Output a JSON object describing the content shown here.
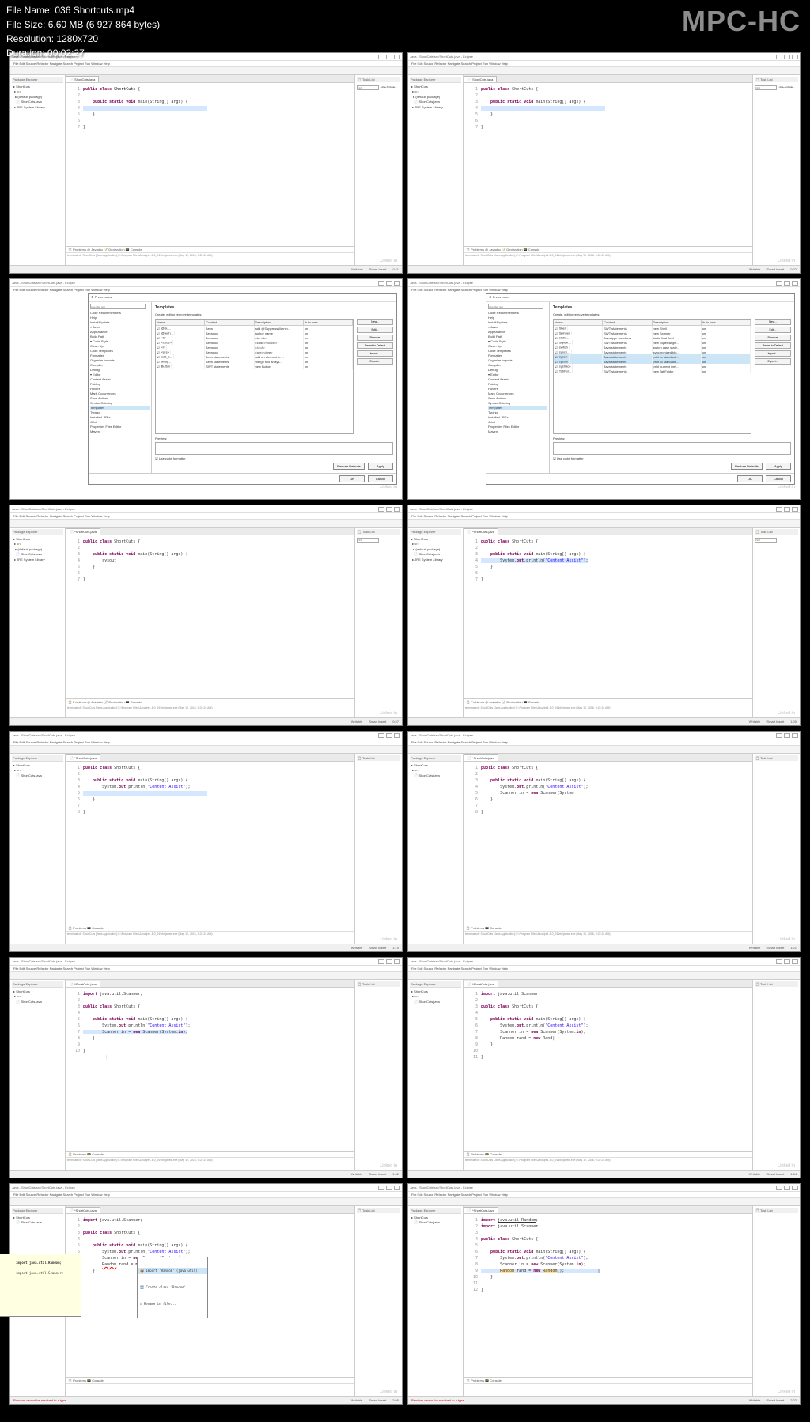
{
  "file_info": {
    "name_lbl": "File Name:",
    "name": "036 Shortcuts.mp4",
    "size_lbl": "File Size:",
    "size": "6.60 MB (6 927 864 bytes)",
    "res_lbl": "Resolution:",
    "res": "1280x720",
    "dur_lbl": "Duration:",
    "dur": "00:02:27"
  },
  "watermark": "MPC-HC",
  "eclipse": {
    "title": "Java - ShortCuts/src/ShortCuts.java - Eclipse",
    "menu": "File  Edit  Source  Refactor  Navigate  Search  Project  Run  Window  Help",
    "pkg_explorer": "Package Explorer",
    "project": "ShortCuts",
    "src": "src",
    "defpkg": "(default package)",
    "javafile": "ShortCuts.java",
    "jre": "JRE System Library",
    "tab": "ShortCuts.java",
    "tasklist": "Task List",
    "find": "Find",
    "all": "All",
    "activate": "Activate...",
    "problems": "Problems",
    "javadoc": "Javadoc",
    "declaration": "Declaration",
    "console": "Console",
    "terminated": "terminated> ShortCuts [Java Application] C:\\Program Files\\Java\\jre1.8.0_91\\bin\\javaw.exe (May 12, 2016, 9:22:24 AM)",
    "status_writable": "Writable",
    "status_insert": "Smart Insert",
    "linkedin": "Linked in"
  },
  "code": {
    "f1_l1": "public class ShortCuts {",
    "f1_l2": "    public static void main(String[] args) {",
    "f1_l3": "    }",
    "f1_l4": "}",
    "f5_l3": "        sysout",
    "f6_l3": "        System.out.println(\"Content Assist\");",
    "f8_l4": "        Scanner in = new Scanner(System",
    "f9_imp": "import java.util.Scanner;",
    "f9_l5": "        Scanner in = new Scanner(System.in);",
    "f10_l6": "        Random rand = new Random",
    "f12_imp1": "import java.util.Random;",
    "f12_imp2": "import java.util.Scanner;",
    "f12_l7": "        Random rand = new Random();"
  },
  "prefs": {
    "title": "Preferences",
    "filter": "type filter text",
    "tree": [
      "Code Recommenders",
      "Help",
      "Install/Update",
      "Java",
      " Appearance",
      " Build Path",
      " Code Style",
      "  Clean Up",
      "  Code Templates",
      "  Formatter",
      "  Organize Imports",
      " Compiler",
      " Debug",
      " Editor",
      "  Content Assist",
      "  Folding",
      "  Hovers",
      "  Mark Occurrences",
      "  Save Actions",
      "  Syntax Coloring",
      "  Templates",
      "  Typing",
      " Installed JREs",
      " JUnit",
      " Properties Files Editor",
      "Maven"
    ],
    "heading": "Templates",
    "desc": "Create, edit or remove templates:",
    "cols": [
      "Name",
      "Context",
      "Description",
      "Auto Inse..."
    ],
    "rows_a": [
      [
        "@Su...",
        "Java",
        "add @SuppressWarnin...",
        "on"
      ],
      [
        "@auth...",
        "Javadoc",
        "author name",
        "on"
      ],
      [
        "<b>",
        "Javadoc",
        "<b></b>",
        "on"
      ],
      [
        "<code>",
        "Javadoc",
        "<code></code>",
        "on"
      ],
      [
        "<i>",
        "Javadoc",
        "<i></i>",
        "on"
      ],
      [
        "<pre>",
        "Javadoc",
        "<pre></pre>",
        "on"
      ],
      [
        "add_e...",
        "Java statements",
        "add an element to ...",
        "on"
      ],
      [
        "array...",
        "Java statements",
        "merge two arrays...",
        "on"
      ],
      [
        "Button",
        "SWT statements",
        "new Button",
        "on"
      ]
    ],
    "rows_b": [
      [
        "Shell",
        "SWT statements",
        "new Shell",
        "on"
      ],
      [
        "Spinner",
        "SWT statements",
        "new Spinner",
        "on"
      ],
      [
        "static...",
        "Java type members",
        "static final field",
        "on"
      ],
      [
        "StyleR...",
        "SWT statements",
        "new StyleRange...",
        "on"
      ],
      [
        "switch",
        "Java statements",
        "switch case state...",
        "on"
      ],
      [
        "synch...",
        "Java statements",
        "synchronized blo...",
        "on"
      ],
      [
        "syserr",
        "Java statements",
        "print to standard...",
        "on"
      ],
      [
        "sysout",
        "Java statements",
        "print to standard...",
        "on"
      ],
      [
        "systrace",
        "Java statements",
        "print current met...",
        "on"
      ],
      [
        "TabFol...",
        "SWT statements",
        "new TabFolder",
        "on"
      ]
    ],
    "preview": "Preview:",
    "usecode": "Use code formatter",
    "btns": [
      "New...",
      "Edit...",
      "Remove",
      "Revert to Default",
      "Import...",
      "Export..."
    ],
    "restore": "Restore Defaults",
    "apply": "Apply",
    "ok": "OK",
    "cancel": "Cancel"
  },
  "autocomplete": {
    "items": [
      "Import 'Random' (java.util)",
      "Create class 'Random'",
      "Rename in file..."
    ]
  },
  "tooltip": {
    "t1": "import java.util.Random;",
    "t2": "import java.util.Scanner;"
  },
  "status_pos": [
    "0:11",
    "0:22",
    "0:33",
    "0:44",
    "0:57",
    "1:00",
    "1:10",
    "1:21",
    "1:42",
    "1:54",
    "2:05",
    "2:22"
  ],
  "err_status": "Random cannot be resolved to a type"
}
